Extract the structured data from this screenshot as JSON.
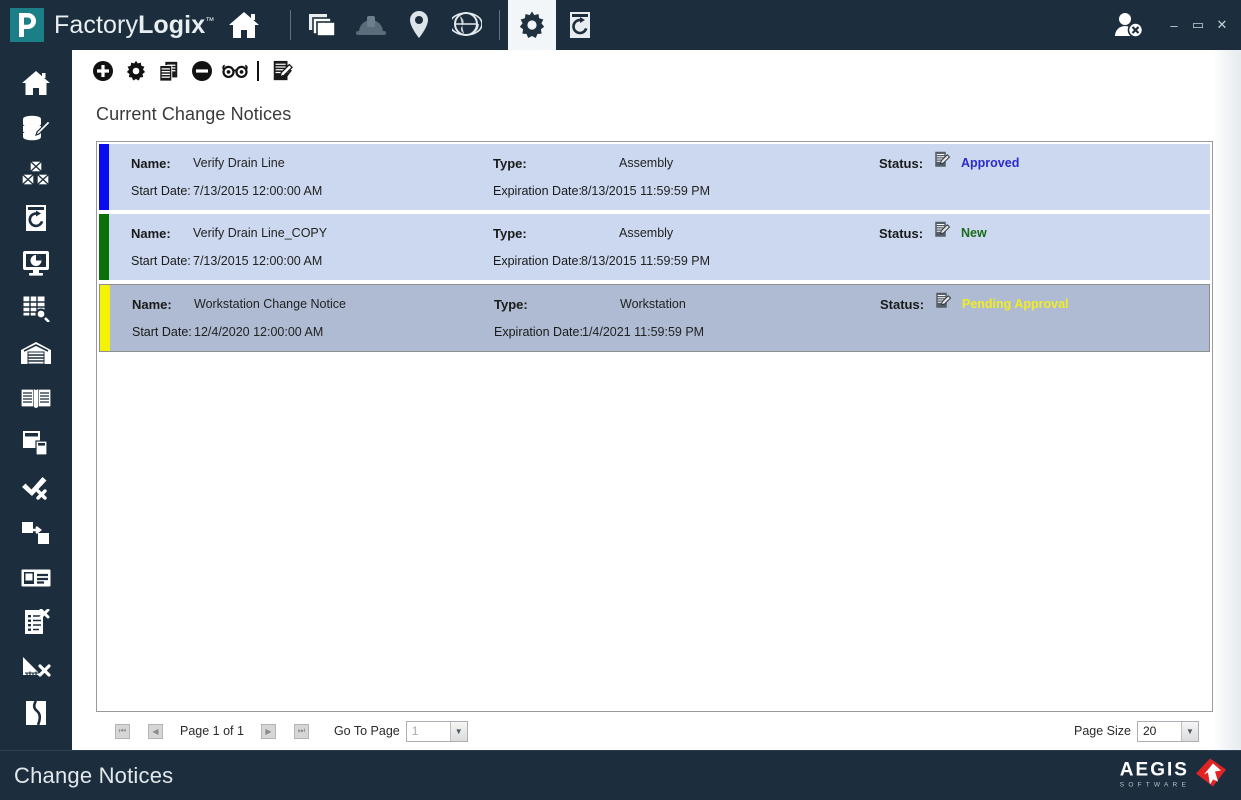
{
  "app": {
    "brand_first": "Factory",
    "brand_second": "Logix",
    "brand_tm": "™"
  },
  "topnav": {
    "home_icon": "home-icon",
    "items": [
      {
        "name": "layers-icon",
        "label": "Layers",
        "active": false
      },
      {
        "name": "hardhat-icon",
        "label": "Hard Hat",
        "active": false
      },
      {
        "name": "location-pin-icon",
        "label": "Location",
        "active": false
      },
      {
        "name": "globe-icon",
        "label": "Globe",
        "active": false
      },
      {
        "name": "gear-icon",
        "label": "Settings",
        "active": true
      },
      {
        "name": "history-icon",
        "label": "History",
        "active": false
      }
    ]
  },
  "window_controls": {
    "user_icon": "user-disabled-icon",
    "minimize": "–",
    "maximize": "▭",
    "close": "✕"
  },
  "sidebar": {
    "items": [
      {
        "name": "sidebar-item-home",
        "icon": "home-icon",
        "label": "Home"
      },
      {
        "name": "sidebar-item-data-entry",
        "icon": "database-edit-icon",
        "label": "Data Entry"
      },
      {
        "name": "sidebar-item-inventory",
        "icon": "boxes-icon",
        "label": "Inventory"
      },
      {
        "name": "sidebar-item-history",
        "icon": "document-refresh-icon",
        "label": "History"
      },
      {
        "name": "sidebar-item-dashboard",
        "icon": "monitor-chart-icon",
        "label": "Dashboard"
      },
      {
        "name": "sidebar-item-query",
        "icon": "table-search-icon",
        "label": "Query"
      },
      {
        "name": "sidebar-item-warehouse",
        "icon": "warehouse-icon",
        "label": "Warehouse"
      },
      {
        "name": "sidebar-item-library",
        "icon": "book-icon",
        "label": "Library"
      },
      {
        "name": "sidebar-item-documents",
        "icon": "documents-icon",
        "label": "Documents"
      },
      {
        "name": "sidebar-item-approvals",
        "icon": "check-x-icon",
        "label": "Approvals"
      },
      {
        "name": "sidebar-item-transfer",
        "icon": "transfer-icon",
        "label": "Transfer"
      },
      {
        "name": "sidebar-item-id-card",
        "icon": "id-card-icon",
        "label": "ID Card"
      },
      {
        "name": "sidebar-item-checklist",
        "icon": "checklist-x-icon",
        "label": "Checklist"
      },
      {
        "name": "sidebar-item-measure",
        "icon": "ruler-x-icon",
        "label": "Measure"
      },
      {
        "name": "sidebar-item-defect",
        "icon": "torn-document-icon",
        "label": "Defect"
      }
    ]
  },
  "content_toolbar": {
    "buttons": [
      {
        "name": "add-button",
        "icon": "plus-circle-icon",
        "label": "Add"
      },
      {
        "name": "settings-button",
        "icon": "gear-icon",
        "label": "Settings"
      },
      {
        "name": "copy-button",
        "icon": "copy-documents-icon",
        "label": "Copy"
      },
      {
        "name": "delete-button",
        "icon": "minus-circle-icon",
        "label": "Delete"
      },
      {
        "name": "view-button",
        "icon": "glasses-icon",
        "label": "View"
      },
      {
        "name": "edit-approve-button",
        "icon": "document-check-icon",
        "label": "Edit / Approve"
      }
    ]
  },
  "page": {
    "title": "Current Change Notices"
  },
  "list": {
    "labels": {
      "name": "Name:",
      "start_date": "Start Date:",
      "type": "Type:",
      "expiration_date": "Expiration Date:",
      "status": "Status:"
    },
    "rows": [
      {
        "accent_color": "#0b0bf0",
        "name": "Verify Drain Line",
        "start_date": "7/13/2015 12:00:00 AM",
        "type": "Assembly",
        "expiration_date": "8/13/2015 11:59:59 PM",
        "status": "Approved",
        "status_color": "#2b2bc9",
        "selected": false
      },
      {
        "accent_color": "#0c7008",
        "name": "Verify Drain Line_COPY",
        "start_date": "7/13/2015 12:00:00 AM",
        "type": "Assembly",
        "expiration_date": "8/13/2015 11:59:59 PM",
        "status": "New",
        "status_color": "#1b6b1b",
        "selected": false
      },
      {
        "accent_color": "#f6f206",
        "name": "Workstation Change Notice",
        "start_date": "12/4/2020 12:00:00 AM",
        "type": "Workstation",
        "expiration_date": "1/4/2021 11:59:59 PM",
        "status": "Pending Approval",
        "status_color": "#f2ec25",
        "selected": true
      }
    ]
  },
  "pager": {
    "first_icon": "⏮",
    "prev_icon": "◀",
    "page_text": "Page 1 of 1",
    "next_icon": "▶",
    "last_icon": "⏭",
    "goto_label": "Go To Page",
    "goto_value": "1",
    "page_size_label": "Page Size",
    "page_size_value": "20"
  },
  "footer": {
    "title": "Change Notices",
    "company": "AEGIS",
    "company_sub": "SOFTWARE"
  },
  "colors": {
    "chrome": "#1c2e3d",
    "row_bg": "#cbd8ef",
    "row_selected_bg": "#aebbd2",
    "brand_teal": "#1b7f88",
    "aegis_red": "#e02424"
  }
}
